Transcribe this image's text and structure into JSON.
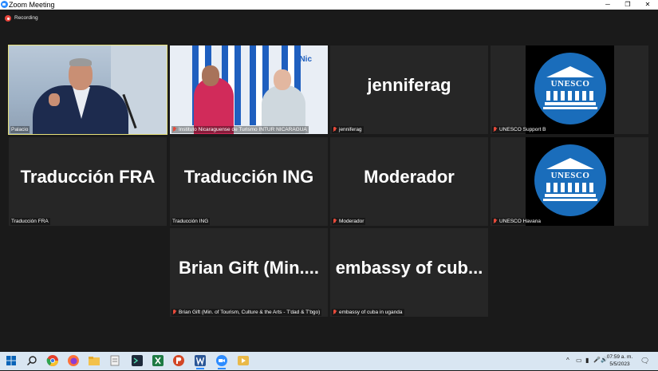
{
  "window": {
    "title": "Zoom Meeting",
    "min": "─",
    "max": "❐",
    "close": "✕"
  },
  "recording": {
    "label": "Recording"
  },
  "tiles": [
    {
      "big": "",
      "name": "Palacio",
      "muted": false,
      "type": "video-palacio"
    },
    {
      "big": "",
      "name": "Instituto Nicaraguense de Turismo INTUR NICARAGUA",
      "muted": true,
      "type": "video-intur"
    },
    {
      "big": "jenniferag",
      "name": "jenniferag",
      "muted": true,
      "type": "text"
    },
    {
      "big": "",
      "name": "UNESCO Support B",
      "muted": true,
      "type": "unesco",
      "logo_text": "UNESCO"
    },
    {
      "big": "Traducción FRA",
      "name": "Traducción FRA",
      "muted": false,
      "type": "text"
    },
    {
      "big": "Traducción ING",
      "name": "Traducción ING",
      "muted": false,
      "type": "text"
    },
    {
      "big": "Moderador",
      "name": "Moderador",
      "muted": true,
      "type": "text"
    },
    {
      "big": "",
      "name": "UNESCO Havana",
      "muted": true,
      "type": "unesco",
      "logo_text": "UNESCO"
    },
    {
      "big": "Brian Gift (Min....",
      "name": "Brian Gift (Min. of Tourism, Culture & the Arts - T'dad & T'bgo)",
      "muted": true,
      "type": "text"
    },
    {
      "big": "embassy of cub...",
      "name": "embassy of cuba in uganda",
      "muted": true,
      "type": "text"
    }
  ],
  "intur_logo": "Nic",
  "taskbar": {
    "icons": [
      "windows-start-icon",
      "search-icon",
      "chrome-icon",
      "firefox-icon",
      "file-explorer-icon",
      "notepad-icon",
      "terminal-icon",
      "excel-icon",
      "powerpoint-icon",
      "word-icon",
      "zoom-icon",
      "media-player-icon"
    ],
    "time": "07:59 a. m.",
    "date": "5/5/2023",
    "tray_glyphs": {
      "chevron": "^",
      "network": "▭",
      "battery": "▮",
      "mic": "🎤",
      "speaker": "🔊",
      "notification": "🗨"
    }
  },
  "colors": {
    "active_speaker": "#e6e07a",
    "mute": "#e64a3a",
    "unesco_blue": "#1a6dbb",
    "zoom_blue": "#2d8cff"
  }
}
